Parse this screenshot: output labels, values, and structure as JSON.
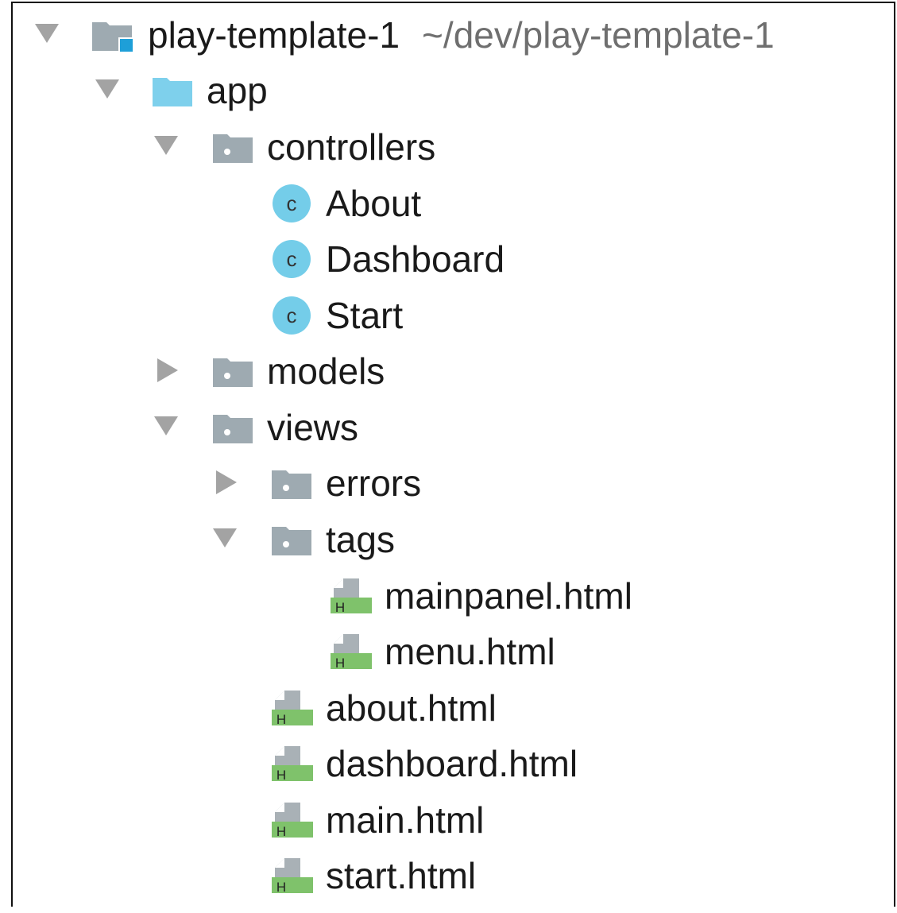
{
  "project_tree": {
    "root": {
      "name": "play-template-1",
      "path": "~/dev/play-template-1",
      "expanded": true,
      "icon": "module-folder-icon"
    },
    "rows": [
      {
        "id": "app",
        "label": "app",
        "type": "source-folder",
        "icon": "source-folder-icon",
        "expanded": true
      },
      {
        "id": "controllers",
        "label": "controllers",
        "type": "package",
        "icon": "package-folder-icon",
        "expanded": true
      },
      {
        "id": "about-class",
        "label": "About",
        "type": "class",
        "icon": "class-icon",
        "icon_letter": "c"
      },
      {
        "id": "dashboard-class",
        "label": "Dashboard",
        "type": "class",
        "icon": "class-icon",
        "icon_letter": "c"
      },
      {
        "id": "start-class",
        "label": "Start",
        "type": "class",
        "icon": "class-icon",
        "icon_letter": "c"
      },
      {
        "id": "models",
        "label": "models",
        "type": "package",
        "icon": "package-folder-icon",
        "expanded": false
      },
      {
        "id": "views",
        "label": "views",
        "type": "package",
        "icon": "package-folder-icon",
        "expanded": true
      },
      {
        "id": "errors",
        "label": "errors",
        "type": "package",
        "icon": "package-folder-icon",
        "expanded": false
      },
      {
        "id": "tags",
        "label": "tags",
        "type": "package",
        "icon": "package-folder-icon",
        "expanded": true
      },
      {
        "id": "mainpanel-html",
        "label": "mainpanel.html",
        "type": "html-file",
        "icon": "html-file-icon",
        "icon_letter": "H"
      },
      {
        "id": "menu-html",
        "label": "menu.html",
        "type": "html-file",
        "icon": "html-file-icon",
        "icon_letter": "H"
      },
      {
        "id": "about-html",
        "label": "about.html",
        "type": "html-file",
        "icon": "html-file-icon",
        "icon_letter": "H"
      },
      {
        "id": "dashboard-html",
        "label": "dashboard.html",
        "type": "html-file",
        "icon": "html-file-icon",
        "icon_letter": "H"
      },
      {
        "id": "main-html",
        "label": "main.html",
        "type": "html-file",
        "icon": "html-file-icon",
        "icon_letter": "H"
      },
      {
        "id": "start-html",
        "label": "start.html",
        "type": "html-file",
        "icon": "html-file-icon",
        "icon_letter": "H"
      }
    ]
  },
  "colors": {
    "arrow": "#a3a3a3",
    "package_folder": "#9eaab1",
    "source_folder": "#7ed0ec",
    "module_accent": "#1e9fd8",
    "class_circle": "#74cde9",
    "html_green": "#7fc26b",
    "html_page": "#a9b1b6",
    "path_text": "#6f6f6f"
  }
}
